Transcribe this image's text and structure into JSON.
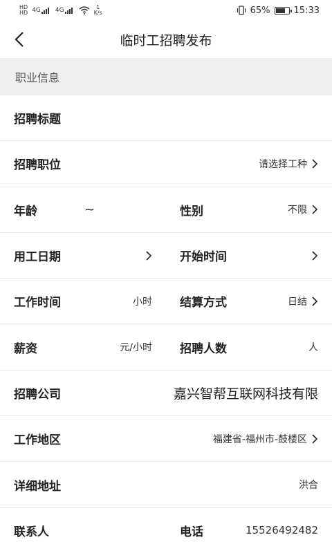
{
  "status_bar": {
    "hd1": "HD",
    "hd2": "HD",
    "signal1": "4G",
    "signal2": "4G",
    "speed_value": "1",
    "speed_unit": "K/s",
    "battery_text": "65%",
    "time": "15:33"
  },
  "header": {
    "title": "临时工招聘发布"
  },
  "section": {
    "title": "职业信息"
  },
  "form": {
    "recruit_title_label": "招聘标题",
    "position_label": "招聘职位",
    "position_value": "请选择工种",
    "age_label": "年龄",
    "age_separator": "~",
    "gender_label": "性别",
    "gender_value": "不限",
    "work_date_label": "用工日期",
    "start_time_label": "开始时间",
    "work_hours_label": "工作时间",
    "work_hours_unit": "小时",
    "settlement_label": "结算方式",
    "settlement_value": "日结",
    "salary_label": "薪资",
    "salary_unit": "元/小时",
    "headcount_label": "招聘人数",
    "headcount_unit": "人",
    "company_label": "招聘公司",
    "company_value": "嘉兴智帮互联网科技有限",
    "region_label": "工作地区",
    "region_value": "福建省-福州市-鼓楼区",
    "address_label": "详细地址",
    "address_value": "洪合",
    "contact_label": "联系人",
    "phone_label": "电话",
    "phone_value": "15526492482"
  }
}
